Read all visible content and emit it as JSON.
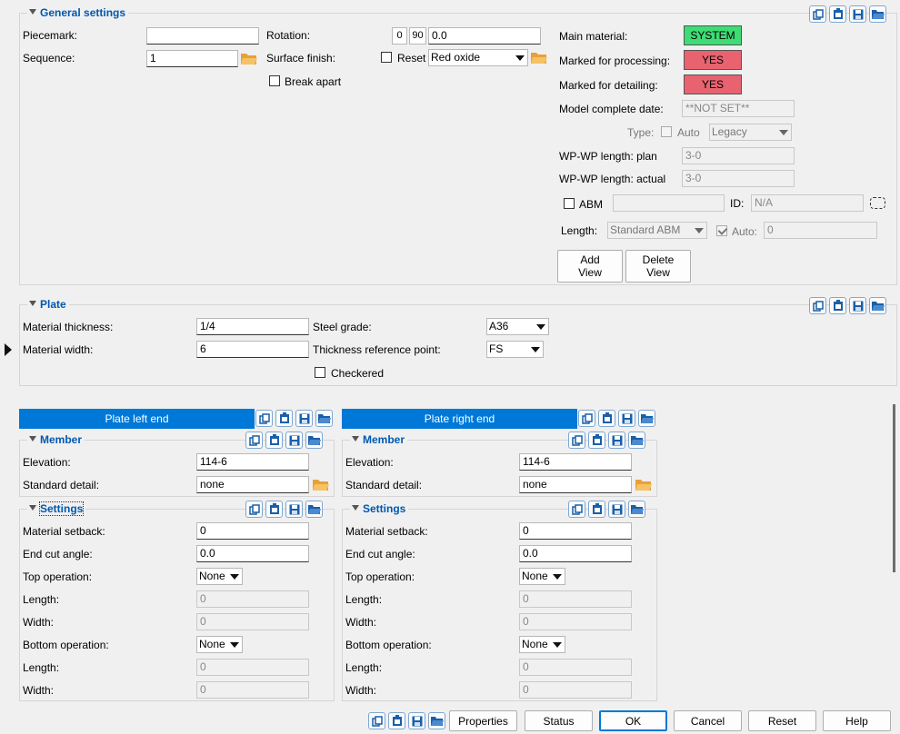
{
  "general": {
    "title": "General settings",
    "piecemark_label": "Piecemark:",
    "piecemark_value": "",
    "sequence_label": "Sequence:",
    "sequence_value": "1",
    "rotation_label": "Rotation:",
    "rotation_btn1": "0",
    "rotation_btn2": "90",
    "rotation_value": "0.0",
    "surface_label": "Surface finish:",
    "reset_label": "Reset",
    "surface_value": "Red oxide",
    "break_apart_label": "Break apart",
    "main_material_label": "Main material:",
    "main_material_value": "SYSTEM",
    "marked_processing_label": "Marked for processing:",
    "marked_processing_value": "YES",
    "marked_detailing_label": "Marked for detailing:",
    "marked_detailing_value": "YES",
    "model_complete_label": "Model complete date:",
    "model_complete_value": "**NOT SET**",
    "type_label": "Type:",
    "auto_label": "Auto",
    "type_value": "Legacy",
    "wp_plan_label": "WP-WP length: plan",
    "wp_plan_value": "3-0",
    "wp_actual_label": "WP-WP length: actual",
    "wp_actual_value": "3-0",
    "abm_label": "ABM",
    "abm_value": "",
    "id_label": "ID:",
    "id_value": "N/A",
    "length_label": "Length:",
    "length_value": "Standard ABM",
    "length_auto_label": "Auto:",
    "length_auto_value": "0",
    "add_view_line1": "Add",
    "add_view_line2": "View",
    "delete_view_line1": "Delete",
    "delete_view_line2": "View"
  },
  "plate": {
    "title": "Plate",
    "thickness_label": "Material thickness:",
    "thickness_value": "1/4",
    "width_label": "Material width:",
    "width_value": "6",
    "grade_label": "Steel grade:",
    "grade_value": "A36",
    "refpoint_label": "Thickness reference point:",
    "refpoint_value": "FS",
    "checkered_label": "Checkered"
  },
  "left": {
    "tab": "Plate left end",
    "member_title": "Member",
    "elevation_label": "Elevation:",
    "elevation_value": "114-6",
    "std_detail_label": "Standard detail:",
    "std_detail_value": "none",
    "settings_title": "Settings",
    "setback_label": "Material setback:",
    "setback_value": "0",
    "cut_angle_label": "End cut angle:",
    "cut_angle_value": "0.0",
    "top_op_label": "Top operation:",
    "top_op_value": "None",
    "top_len_label": "Length:",
    "top_len_value": "0",
    "top_wid_label": "Width:",
    "top_wid_value": "0",
    "bot_op_label": "Bottom operation:",
    "bot_op_value": "None",
    "bot_len_label": "Length:",
    "bot_len_value": "0",
    "bot_wid_label": "Width:",
    "bot_wid_value": "0"
  },
  "right": {
    "tab": "Plate right end",
    "member_title": "Member",
    "elevation_label": "Elevation:",
    "elevation_value": "114-6",
    "std_detail_label": "Standard detail:",
    "std_detail_value": "none",
    "settings_title": "Settings",
    "setback_label": "Material setback:",
    "setback_value": "0",
    "cut_angle_label": "End cut angle:",
    "cut_angle_value": "0.0",
    "top_op_label": "Top operation:",
    "top_op_value": "None",
    "top_len_label": "Length:",
    "top_len_value": "0",
    "top_wid_label": "Width:",
    "top_wid_value": "0",
    "bot_op_label": "Bottom operation:",
    "bot_op_value": "None",
    "bot_len_label": "Length:",
    "bot_len_value": "0",
    "bot_wid_label": "Width:",
    "bot_wid_value": "0"
  },
  "footer": {
    "properties": "Properties",
    "status": "Status",
    "ok": "OK",
    "cancel": "Cancel",
    "reset": "Reset",
    "help": "Help"
  },
  "colors": {
    "system": "#3ddc74",
    "yes": "#e8636f",
    "accent": "#0078d7"
  }
}
